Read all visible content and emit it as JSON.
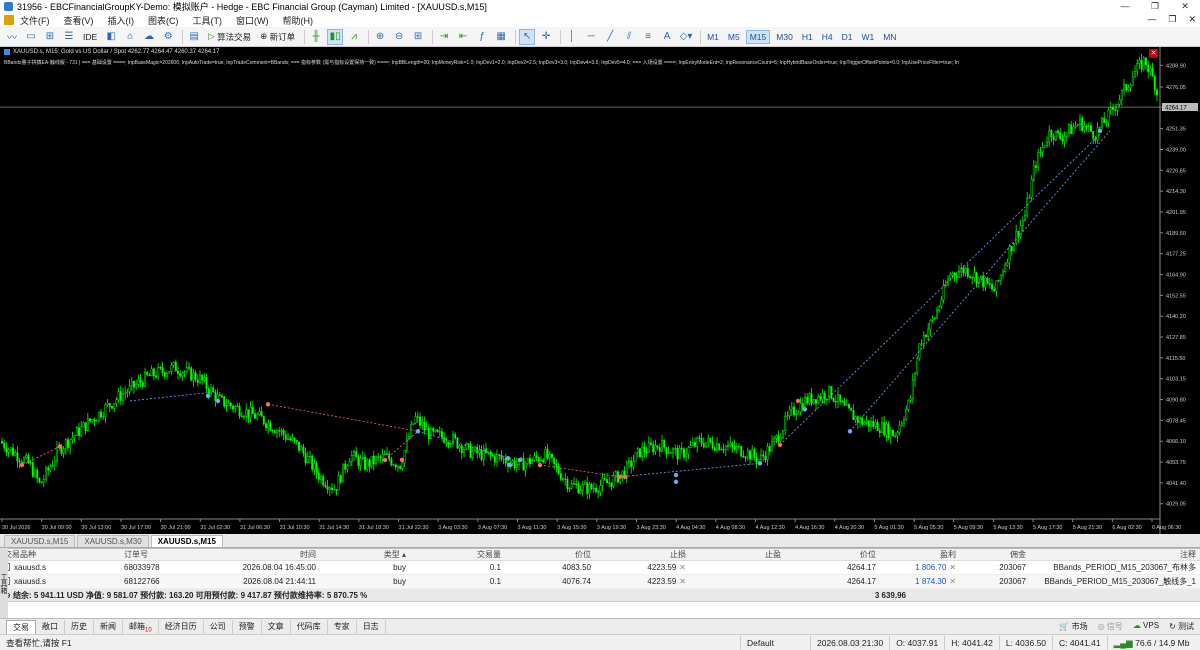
{
  "window": {
    "title": "31956 - EBCFinancialGroupKY-Demo: 模拟账户 - Hedge - EBC Financial Group (Cayman) Limited - [XAUUSD.s,M15]",
    "controls": [
      "—",
      "❐",
      "✕"
    ]
  },
  "menu": {
    "items": [
      "文件(F)",
      "查看(V)",
      "插入(I)",
      "图表(C)",
      "工具(T)",
      "窗口(W)",
      "帮助(H)"
    ],
    "right": [
      "—",
      "❐",
      "✕"
    ]
  },
  "toolbar": {
    "algo_trading": "算法交易",
    "new_order": "新订单",
    "ide": "IDE",
    "timeframes": [
      "M1",
      "M5",
      "M15",
      "M30",
      "H1",
      "H4",
      "D1",
      "W1",
      "MN"
    ],
    "active_timeframe": "M15"
  },
  "chart": {
    "header": "XAUUSD.s, M15:  Gold vs US Dollar / Spot   4262.77  4264.47  4260.37  4264.17",
    "params": "BBands量子拼搏EA-触线版 - 731 | === 基础设置 ====; InpBaseMagic=202606; InpAutoTrade=true; InpTradeComment=BBands; === 指标参数 (需与指标设置保持一致) ====; InpBBLength=20; InpMoneyRisk=1.0; InpDev1=2.0; InpDev2=2.5; InpDev3=3.0; InpDev4=3.5; InpDev5=4.0; === 入场设置 ====; InpEntryModeEnt=2; InpResonanceCount=5; InpHybridBaseOrder=true; InpTriggerOffsetPoints=0.0; InpUsePriceFilter=true; In",
    "current_price": "4264.17",
    "price_ticks": [
      "4288.90",
      "4276.05",
      "4264.17",
      "4251.35",
      "4239.00",
      "4226.65",
      "4214.30",
      "4201.95",
      "4189.60",
      "4177.25",
      "4164.90",
      "4152.55",
      "4140.20",
      "4127.85",
      "4115.50",
      "4103.15",
      "4090.80",
      "4078.45",
      "4066.10",
      "4053.75",
      "4041.40",
      "4029.05"
    ],
    "time_ticks": [
      "30 Jul 2026",
      "30 Jul 09:00",
      "30 Jul 13:00",
      "30 Jul 17:00",
      "30 Jul 21:00",
      "31 Jul 02:30",
      "31 Jul 06:30",
      "31 Jul 10:30",
      "31 Jul 14:30",
      "31 Jul 18:30",
      "31 Jul 22:30",
      "3 Aug 03:30",
      "3 Aug 07:30",
      "3 Aug 11:30",
      "3 Aug 15:30",
      "3 Aug 19:30",
      "3 Aug 23:30",
      "4 Aug 04:30",
      "4 Aug 08:30",
      "4 Aug 12:30",
      "4 Aug 16:30",
      "4 Aug 20:30",
      "5 Aug 01:30",
      "5 Aug 05:30",
      "5 Aug 09:30",
      "5 Aug 13:30",
      "5 Aug 17:30",
      "5 Aug 21:30",
      "6 Aug 02:30",
      "6 Aug 06:30"
    ],
    "colors": {
      "up": "#00ff00",
      "down": "#00ff00",
      "background": "#000000",
      "sell_marker": "#ff6b5a",
      "buy_marker": "#6fa8ff"
    }
  },
  "chart_tabs": [
    "XAUUSD.s,M15",
    "XAUUSD.s,M30",
    "XAUUSD.s,M15"
  ],
  "terminal": {
    "columns": [
      "交易品种",
      "订单号",
      "时间",
      "类型",
      "交易量",
      "价位",
      "止损",
      "止盈",
      "价位",
      "盈利",
      "佣金",
      "注释"
    ],
    "rows": [
      {
        "symbol": "xauusd.s",
        "ticket": "68033978",
        "time": "2026.08.04 16:45:00",
        "type": "buy",
        "volume": "0.1",
        "price": "4083.50",
        "sl": "4223.59",
        "tp": "",
        "cur": "4264.17",
        "profit": "1 806.70",
        "swap": "203067",
        "comment": "BBands_PERIOD_M15_203067_布林多"
      },
      {
        "symbol": "xauusd.s",
        "ticket": "68122766",
        "time": "2026.08.04 21:44:11",
        "type": "buy",
        "volume": "0.1",
        "price": "4076.74",
        "sl": "4223.59",
        "tp": "",
        "cur": "4264.17",
        "profit": "1 874.30",
        "swap": "203067",
        "comment": "BBands_PERIOD_M15_203067_触线多_1"
      }
    ],
    "summary": "结余: 5 941.11 USD  净值: 9 581.07  预付款: 163.20  可用预付款: 9 417.87  预付款维持率: 5 870.75 %",
    "summary_profit": "3 639.96",
    "tabs": [
      "交易",
      "敞口",
      "历史",
      "新闻",
      "邮箱",
      "经济日历",
      "公司",
      "预警",
      "文章",
      "代码库",
      "专家",
      "日志"
    ],
    "mail_count": "10",
    "right_tabs": [
      "市场",
      "信号",
      "VPS",
      "测试"
    ]
  },
  "statusbar": {
    "help": "查看帮忙,请按 F1",
    "profile": "Default",
    "datetime": "2026.08.03 21:30",
    "open": "O: 4037.91",
    "high": "H: 4041.42",
    "low": "L: 4036.50",
    "close": "C: 4041.41",
    "traffic": "76.6 / 14.9 Mb"
  }
}
